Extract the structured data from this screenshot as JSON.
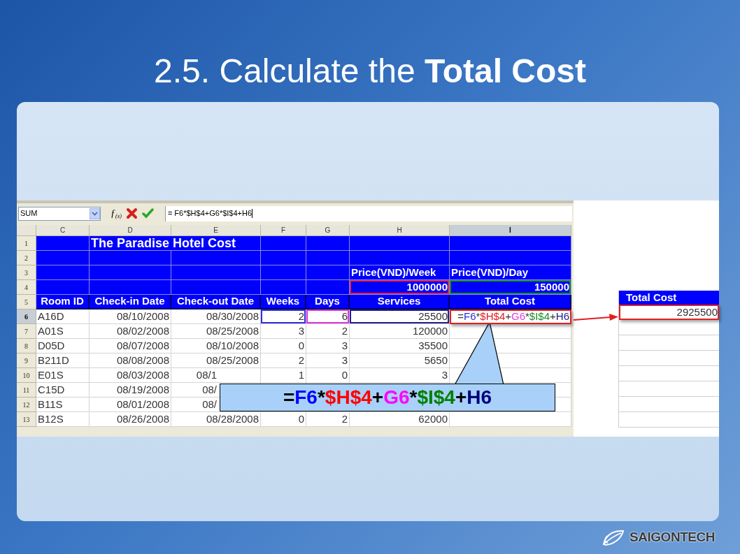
{
  "slide": {
    "title": "2.5. Calculate the **Total Cost**"
  },
  "formula_bar": {
    "name_box": "SUM",
    "function_button": "ƒ$_{(x)}$",
    "formula": "= F6*$H$4+G6*$I$4+H6"
  },
  "sheet": {
    "columns": [
      {
        "label": "C",
        "selected": false
      },
      {
        "label": "D",
        "selected": false
      },
      {
        "label": "E",
        "selected": false
      },
      {
        "label": "F",
        "selected": false
      },
      {
        "label": "G",
        "selected": false
      },
      {
        "label": "H",
        "selected": false
      },
      {
        "label": "I",
        "selected": true
      }
    ],
    "rows": [
      {
        "number": "1",
        "selected": false,
        "kind": "title",
        "cells": [
          {},
          {
            "text": "The Paradise Hotel Cost",
            "merged": true
          },
          {},
          {},
          {},
          {}
        ]
      },
      {
        "number": "2",
        "selected": false,
        "kind": "banner",
        "cells": [
          {},
          {},
          {},
          {},
          {},
          {},
          {}
        ]
      },
      {
        "number": "3",
        "selected": false,
        "kind": "banner",
        "cells": [
          {},
          {},
          {},
          {},
          {},
          {
            "text": "Price(VND)/Week"
          },
          {
            "text": "Price(VND)/Day"
          }
        ]
      },
      {
        "number": "4",
        "selected": false,
        "kind": "banner-values",
        "cells": [
          {},
          {},
          {},
          {},
          {},
          {
            "text": "1000000",
            "color": "#e0204a"
          },
          {
            "text": "150000",
            "color": "#1a8a2a"
          }
        ]
      },
      {
        "number": "5",
        "selected": false,
        "kind": "header",
        "cells": [
          {
            "text": "Room ID"
          },
          {
            "text": "Check-in Date"
          },
          {
            "text": "Check-out Date"
          },
          {
            "text": "Weeks"
          },
          {
            "text": "Days"
          },
          {
            "text": "Services"
          },
          {
            "text": "Total Cost"
          }
        ]
      },
      {
        "number": "6",
        "selected": true,
        "kind": "data",
        "cells": [
          {
            "text": "A16D"
          },
          {
            "text": "08/10/2008"
          },
          {
            "text": "08/30/2008"
          },
          {
            "text": "2",
            "color": "#3030e0"
          },
          {
            "text": "6",
            "color": "#e030e0"
          },
          {
            "text": "25500",
            "color": "#202090"
          },
          {
            "highlighted": true,
            "parts": [
              {
                "text": "= "
              },
              {
                "text": "F6",
                "color": "#3030e0"
              },
              {
                "text": "*"
              },
              {
                "text": "$H$4",
                "color": "#e02020"
              },
              {
                "text": "+"
              },
              {
                "text": "G6",
                "color": "#e040e0"
              },
              {
                "text": "*"
              },
              {
                "text": "$I$4",
                "color": "#1a8a2a"
              },
              {
                "text": "+"
              },
              {
                "text": "H6",
                "color": "#202090"
              }
            ]
          }
        ]
      },
      {
        "number": "7",
        "selected": false,
        "kind": "data",
        "cells": [
          {
            "text": "A01S"
          },
          {
            "text": "08/02/2008"
          },
          {
            "text": "08/25/2008"
          },
          {
            "text": "3"
          },
          {
            "text": "2"
          },
          {
            "text": "120000"
          },
          {}
        ]
      },
      {
        "number": "8",
        "selected": false,
        "kind": "data",
        "cells": [
          {
            "text": "D05D"
          },
          {
            "text": "08/07/2008"
          },
          {
            "text": "08/10/2008"
          },
          {
            "text": "0"
          },
          {
            "text": "3"
          },
          {
            "text": "35500"
          },
          {}
        ]
      },
      {
        "number": "9",
        "selected": false,
        "kind": "data",
        "cells": [
          {
            "text": "B211D"
          },
          {
            "text": "08/08/2008"
          },
          {
            "text": "08/25/2008"
          },
          {
            "text": "2"
          },
          {
            "text": "3"
          },
          {
            "text": "5650"
          },
          {}
        ]
      },
      {
        "number": "10",
        "selected": false,
        "kind": "data",
        "cells": [
          {
            "text": "E01S"
          },
          {
            "text": "08/03/2008"
          },
          {
            "text": "08/1",
            "partial": true
          },
          {
            "text": "1"
          },
          {
            "text": "0"
          },
          {
            "text": "3"
          },
          {}
        ]
      },
      {
        "number": "11",
        "selected": false,
        "kind": "data",
        "cells": [
          {
            "text": "C15D"
          },
          {
            "text": "08/19/2008"
          },
          {
            "text": "08/",
            "partial": true
          },
          {},
          {},
          {},
          {}
        ]
      },
      {
        "number": "12",
        "selected": false,
        "kind": "data",
        "cells": [
          {
            "text": "B11S"
          },
          {
            "text": "08/01/2008"
          },
          {
            "text": "08/",
            "partial": true
          },
          {},
          {},
          {},
          {}
        ]
      },
      {
        "number": "13",
        "selected": false,
        "kind": "data",
        "cells": [
          {
            "text": "B12S"
          },
          {
            "text": "08/26/2008"
          },
          {
            "text": "08/28/2008"
          },
          {
            "text": "0"
          },
          {
            "text": "2"
          },
          {
            "text": "62000"
          },
          {}
        ]
      }
    ]
  },
  "callout": {
    "parts": [
      {
        "text": "= "
      },
      {
        "text": "F6",
        "color": "#0000ff"
      },
      {
        "text": "*"
      },
      {
        "text": "$H$4",
        "color": "#ff0000"
      },
      {
        "text": "+"
      },
      {
        "text": "G6",
        "color": "#ff00ff"
      },
      {
        "text": "*"
      },
      {
        "text": "$I$4",
        "color": "#008000"
      },
      {
        "text": "+"
      },
      {
        "text": "H6",
        "color": "#000080"
      }
    ]
  },
  "result": {
    "header": "Total Cost",
    "value": "2925500",
    "highlighted": true
  },
  "logo": {
    "text": "SAIGONTECH"
  }
}
